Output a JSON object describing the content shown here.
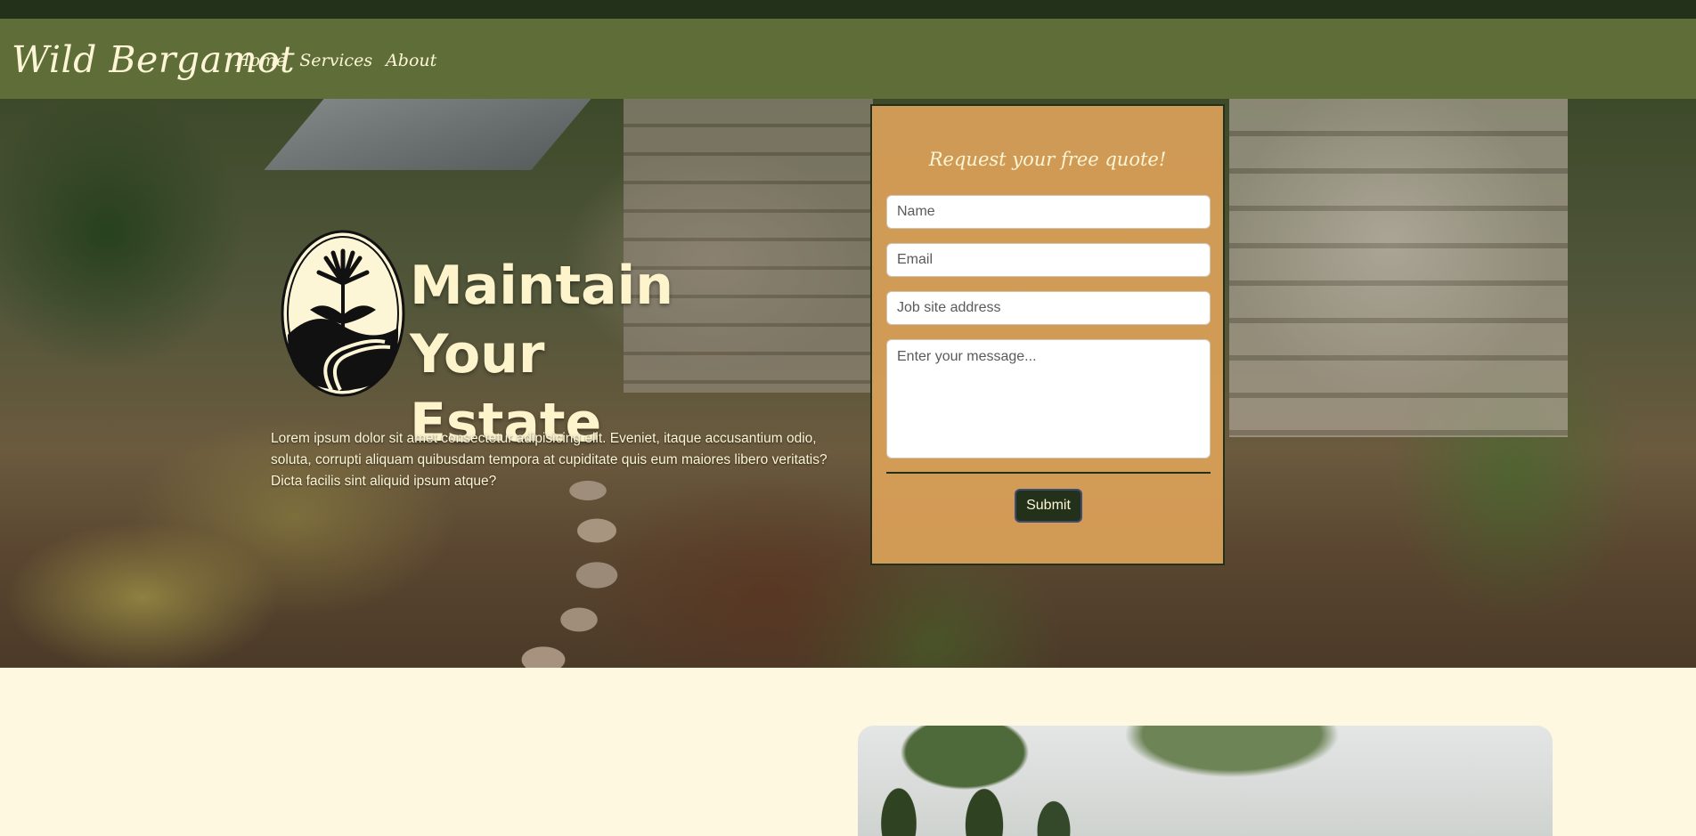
{
  "header": {
    "brand": "Wild Bergamot",
    "nav": [
      "Home",
      "Services",
      "About"
    ]
  },
  "hero": {
    "title_line1": "Maintain",
    "title_line2": "Your Estate",
    "description": "Lorem ipsum dolor sit amet consectetur adipisicing elit. Eveniet, itaque accusantium odio, soluta, corrupti aliquam quibusdam tempora at cupiditate quis eum maiores libero veritatis? Dicta facilis sint aliquid ipsum atque?"
  },
  "quote_form": {
    "title": "Request your free quote!",
    "name_placeholder": "Name",
    "email_placeholder": "Email",
    "address_placeholder": "Job site address",
    "message_placeholder": "Enter your message...",
    "submit_label": "Submit"
  },
  "colors": {
    "topstrip": "#23301a",
    "navbar": "#5f6e38",
    "cream": "#fdf8df",
    "card": "#da9f58"
  }
}
